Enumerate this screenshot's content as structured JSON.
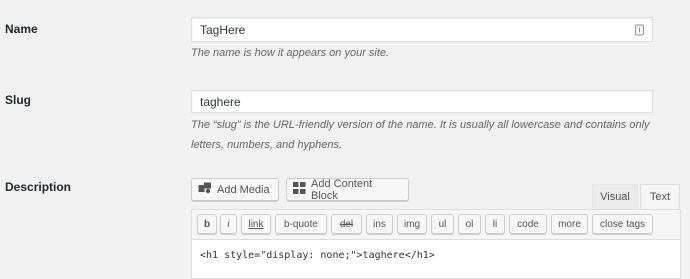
{
  "name_field": {
    "label": "Name",
    "value": "TagHere",
    "icon": "vcard-icon",
    "description": "The name is how it appears on your site."
  },
  "slug_field": {
    "label": "Slug",
    "value": "taghere",
    "description": "The “slug” is the URL-friendly version of the name. It is usually all lowercase and contains only letters, numbers, and hyphens."
  },
  "description_field": {
    "label": "Description",
    "add_media_label": "Add Media",
    "add_content_block_label": "Add Content Block",
    "tabs": {
      "visual": "Visual",
      "text": "Text"
    },
    "quicktags": {
      "b": "b",
      "i": "i",
      "link": "link",
      "b_quote": "b-quote",
      "del": "del",
      "ins": "ins",
      "img": "img",
      "ul": "ul",
      "ol": "ol",
      "li": "li",
      "code": "code",
      "more": "more",
      "close_tags": "close tags"
    },
    "content": "<h1 style=\"display: none;\">taghere</h1>"
  }
}
